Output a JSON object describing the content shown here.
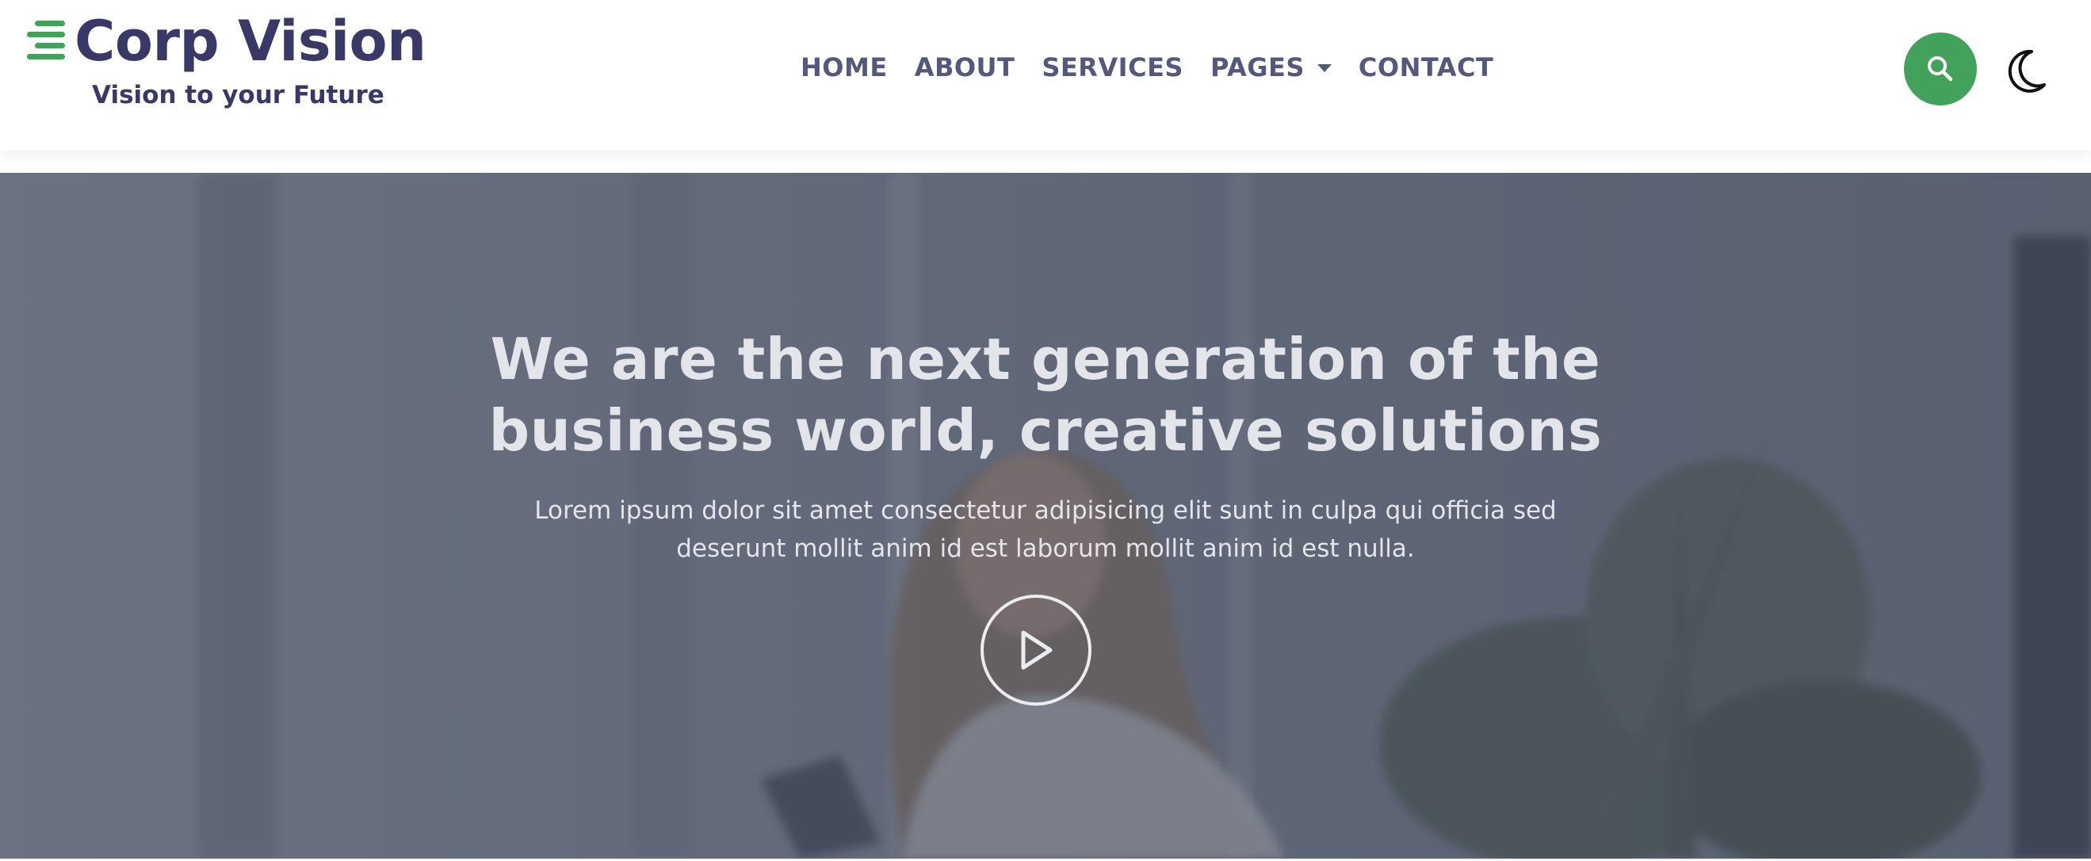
{
  "brand": {
    "name": "Corp Vision",
    "tagline": "Vision to your Future",
    "logo_icon": "menu-lines-icon",
    "accent_color": "#42a15b",
    "text_color": "#3a3866"
  },
  "nav": {
    "items": [
      {
        "label": "HOME"
      },
      {
        "label": "ABOUT"
      },
      {
        "label": "SERVICES"
      },
      {
        "label": "PAGES",
        "has_dropdown": true
      },
      {
        "label": "CONTACT"
      }
    ]
  },
  "header_actions": {
    "search_icon": "search-icon",
    "theme_icon": "moon-icon"
  },
  "hero": {
    "title_line1": "We are the next generation of the",
    "title_line2": "business world, creative solutions",
    "description": "Lorem ipsum dolor sit amet consectetur adipisicing elit sunt in culpa qui officia sed deserunt mollit anim id est laborum mollit anim id est nulla.",
    "play_icon": "play-icon"
  }
}
